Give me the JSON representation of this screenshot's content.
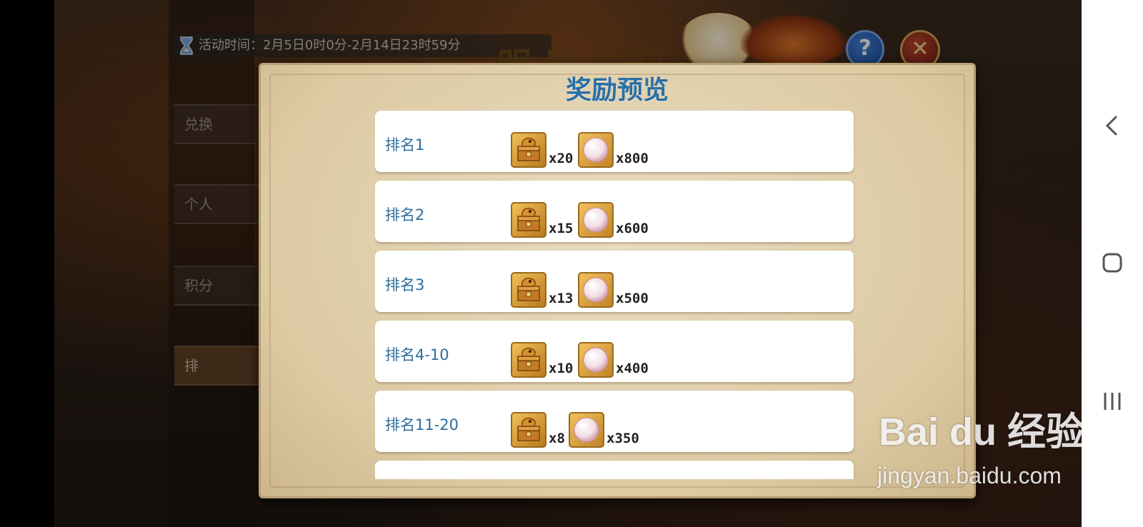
{
  "header": {
    "activity_time": "活动时间：2月5日0时0分-2月14日23时59分",
    "title": "明月光空"
  },
  "sidebar": {
    "items": [
      {
        "label": "兑换"
      },
      {
        "label": "个人"
      },
      {
        "label": "积分"
      },
      {
        "label": "排"
      }
    ]
  },
  "dialog": {
    "title": "奖励预览",
    "rows": [
      {
        "rank": "排名1",
        "item1_count": "x20",
        "item2_count": "x800"
      },
      {
        "rank": "排名2",
        "item1_count": "x15",
        "item2_count": "x600"
      },
      {
        "rank": "排名3",
        "item1_count": "x13",
        "item2_count": "x500"
      },
      {
        "rank": "排名4-10",
        "item1_count": "x10",
        "item2_count": "x400"
      },
      {
        "rank": "排名11-20",
        "item1_count": "x8",
        "item2_count": "x350"
      },
      {
        "rank": "",
        "item1_count": "",
        "item2_count": ""
      }
    ]
  },
  "icons": {
    "help": "?",
    "close": "✕",
    "chest": "dragon-chest-icon",
    "pearl": "pearl-icon"
  },
  "watermark": {
    "logo": "Bai du 经验",
    "url": "jingyan.baidu.com"
  },
  "colors": {
    "rank_text": "#2e6d9c",
    "dialog_title": "#2a6fa6",
    "parchment": "#dccaa3"
  }
}
